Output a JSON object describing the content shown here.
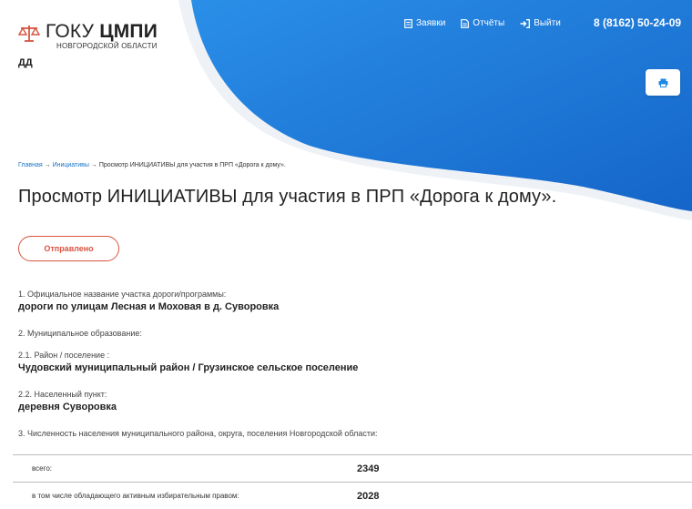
{
  "header": {
    "logo_main": "ГОКУ",
    "logo_main_bold": "ЦМПИ",
    "logo_sub": "НОВГОРОДСКОЙ ОБЛАСТИ",
    "user_initials": "ДД",
    "nav": [
      {
        "label": "Заявки",
        "icon": "document-icon"
      },
      {
        "label": "Отчёты",
        "icon": "report-icon"
      },
      {
        "label": "Выйти",
        "icon": "logout-icon"
      }
    ],
    "phone": "8 (8162) 50-24-09"
  },
  "breadcrumb": {
    "home": "Главная",
    "separator": "→",
    "section": "Инициативы",
    "current": "Просмотр ИНИЦИАТИВЫ для участия в ПРП «Дорога к дому»."
  },
  "page": {
    "title": "Просмотр ИНИЦИАТИВЫ для участия в ПРП «Дорога к дому».",
    "status": "Отправлено"
  },
  "fields": [
    {
      "label": "1. Официальное название участка дороги/программы:",
      "value": "дороги по улицам Лесная и Моховая в д. Суворовка"
    },
    {
      "label": "2. Муниципальное образование:",
      "value": ""
    },
    {
      "label": "2.1. Район / поселение :",
      "value": "Чудовский муниципальный район / Грузинское сельское поселение"
    },
    {
      "label": "2.2. Населенный пункт:",
      "value": "деревня Суворовка"
    },
    {
      "label": "3. Численность населения муниципального района, округа, поселения Новгородской области:",
      "value": ""
    }
  ],
  "population": [
    {
      "label": "всего:",
      "value": "2349"
    },
    {
      "label": "в том числе обладающего активным избирательным правом:",
      "value": "2028"
    }
  ],
  "colors": {
    "accent_blue": "#1e88e5",
    "status_red": "#d9533f",
    "link_blue": "#1a73c8"
  }
}
